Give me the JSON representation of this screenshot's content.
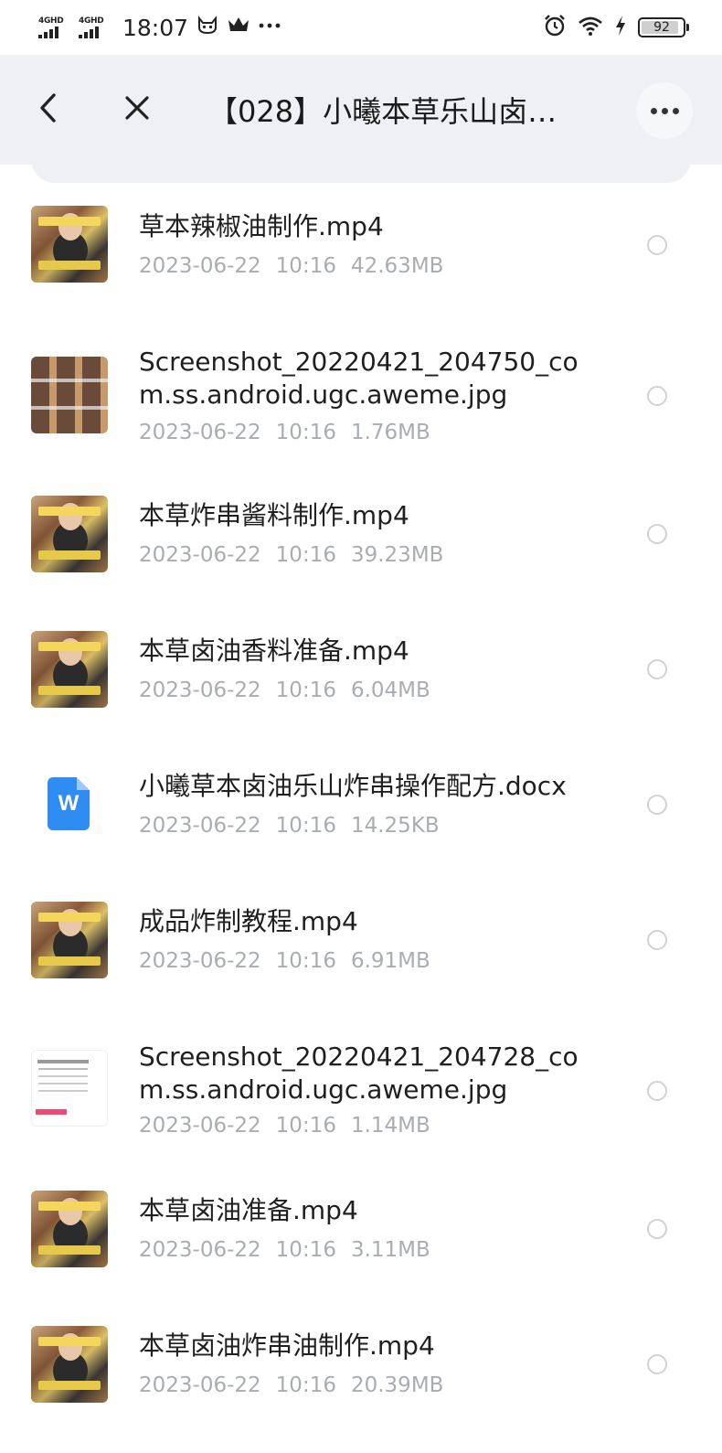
{
  "status_bar": {
    "network_1": "4GHD",
    "network_2": "4GHD",
    "time": "18:07",
    "icons": [
      "cat-face-icon",
      "crown-icon",
      "more-dots-icon",
      "alarm-icon",
      "wifi-icon",
      "charging-icon"
    ],
    "battery": "92",
    "battery_level": 0.92
  },
  "header": {
    "title": "【028】小曦本草乐山卤…",
    "back_icon": "chevron-left-icon",
    "close_icon": "close-icon",
    "more_icon": "more-icon"
  },
  "files": [
    {
      "name": "草本辣椒油制作.mp4",
      "date": "2023-06-22",
      "time": "10:16",
      "size": "42.63MB",
      "thumb": "video"
    },
    {
      "name": "Screenshot_20220421_204750_com.ss.android.ugc.aweme.jpg",
      "date": "2023-06-22",
      "time": "10:16",
      "size": "1.76MB",
      "thumb": "image"
    },
    {
      "name": "本草炸串酱料制作.mp4",
      "date": "2023-06-22",
      "time": "10:16",
      "size": "39.23MB",
      "thumb": "video"
    },
    {
      "name": "本草卤油香料准备.mp4",
      "date": "2023-06-22",
      "time": "10:16",
      "size": "6.04MB",
      "thumb": "video"
    },
    {
      "name": "小曦草本卤油乐山炸串操作配方.docx",
      "date": "2023-06-22",
      "time": "10:16",
      "size": "14.25KB",
      "thumb": "docx",
      "icon_letter": "W"
    },
    {
      "name": "成品炸制教程.mp4",
      "date": "2023-06-22",
      "time": "10:16",
      "size": "6.91MB",
      "thumb": "video"
    },
    {
      "name": "Screenshot_20220421_204728_com.ss.android.ugc.aweme.jpg",
      "date": "2023-06-22",
      "time": "10:16",
      "size": "1.14MB",
      "thumb": "screenshot"
    },
    {
      "name": "本草卤油准备.mp4",
      "date": "2023-06-22",
      "time": "10:16",
      "size": "3.11MB",
      "thumb": "video"
    },
    {
      "name": "本草卤油炸串油制作.mp4",
      "date": "2023-06-22",
      "time": "10:16",
      "size": "20.39MB",
      "thumb": "video"
    }
  ],
  "colors": {
    "header_bg": "#eef0f3",
    "meta_text": "#a9adb3",
    "docx_icon": "#2f8cf2"
  }
}
